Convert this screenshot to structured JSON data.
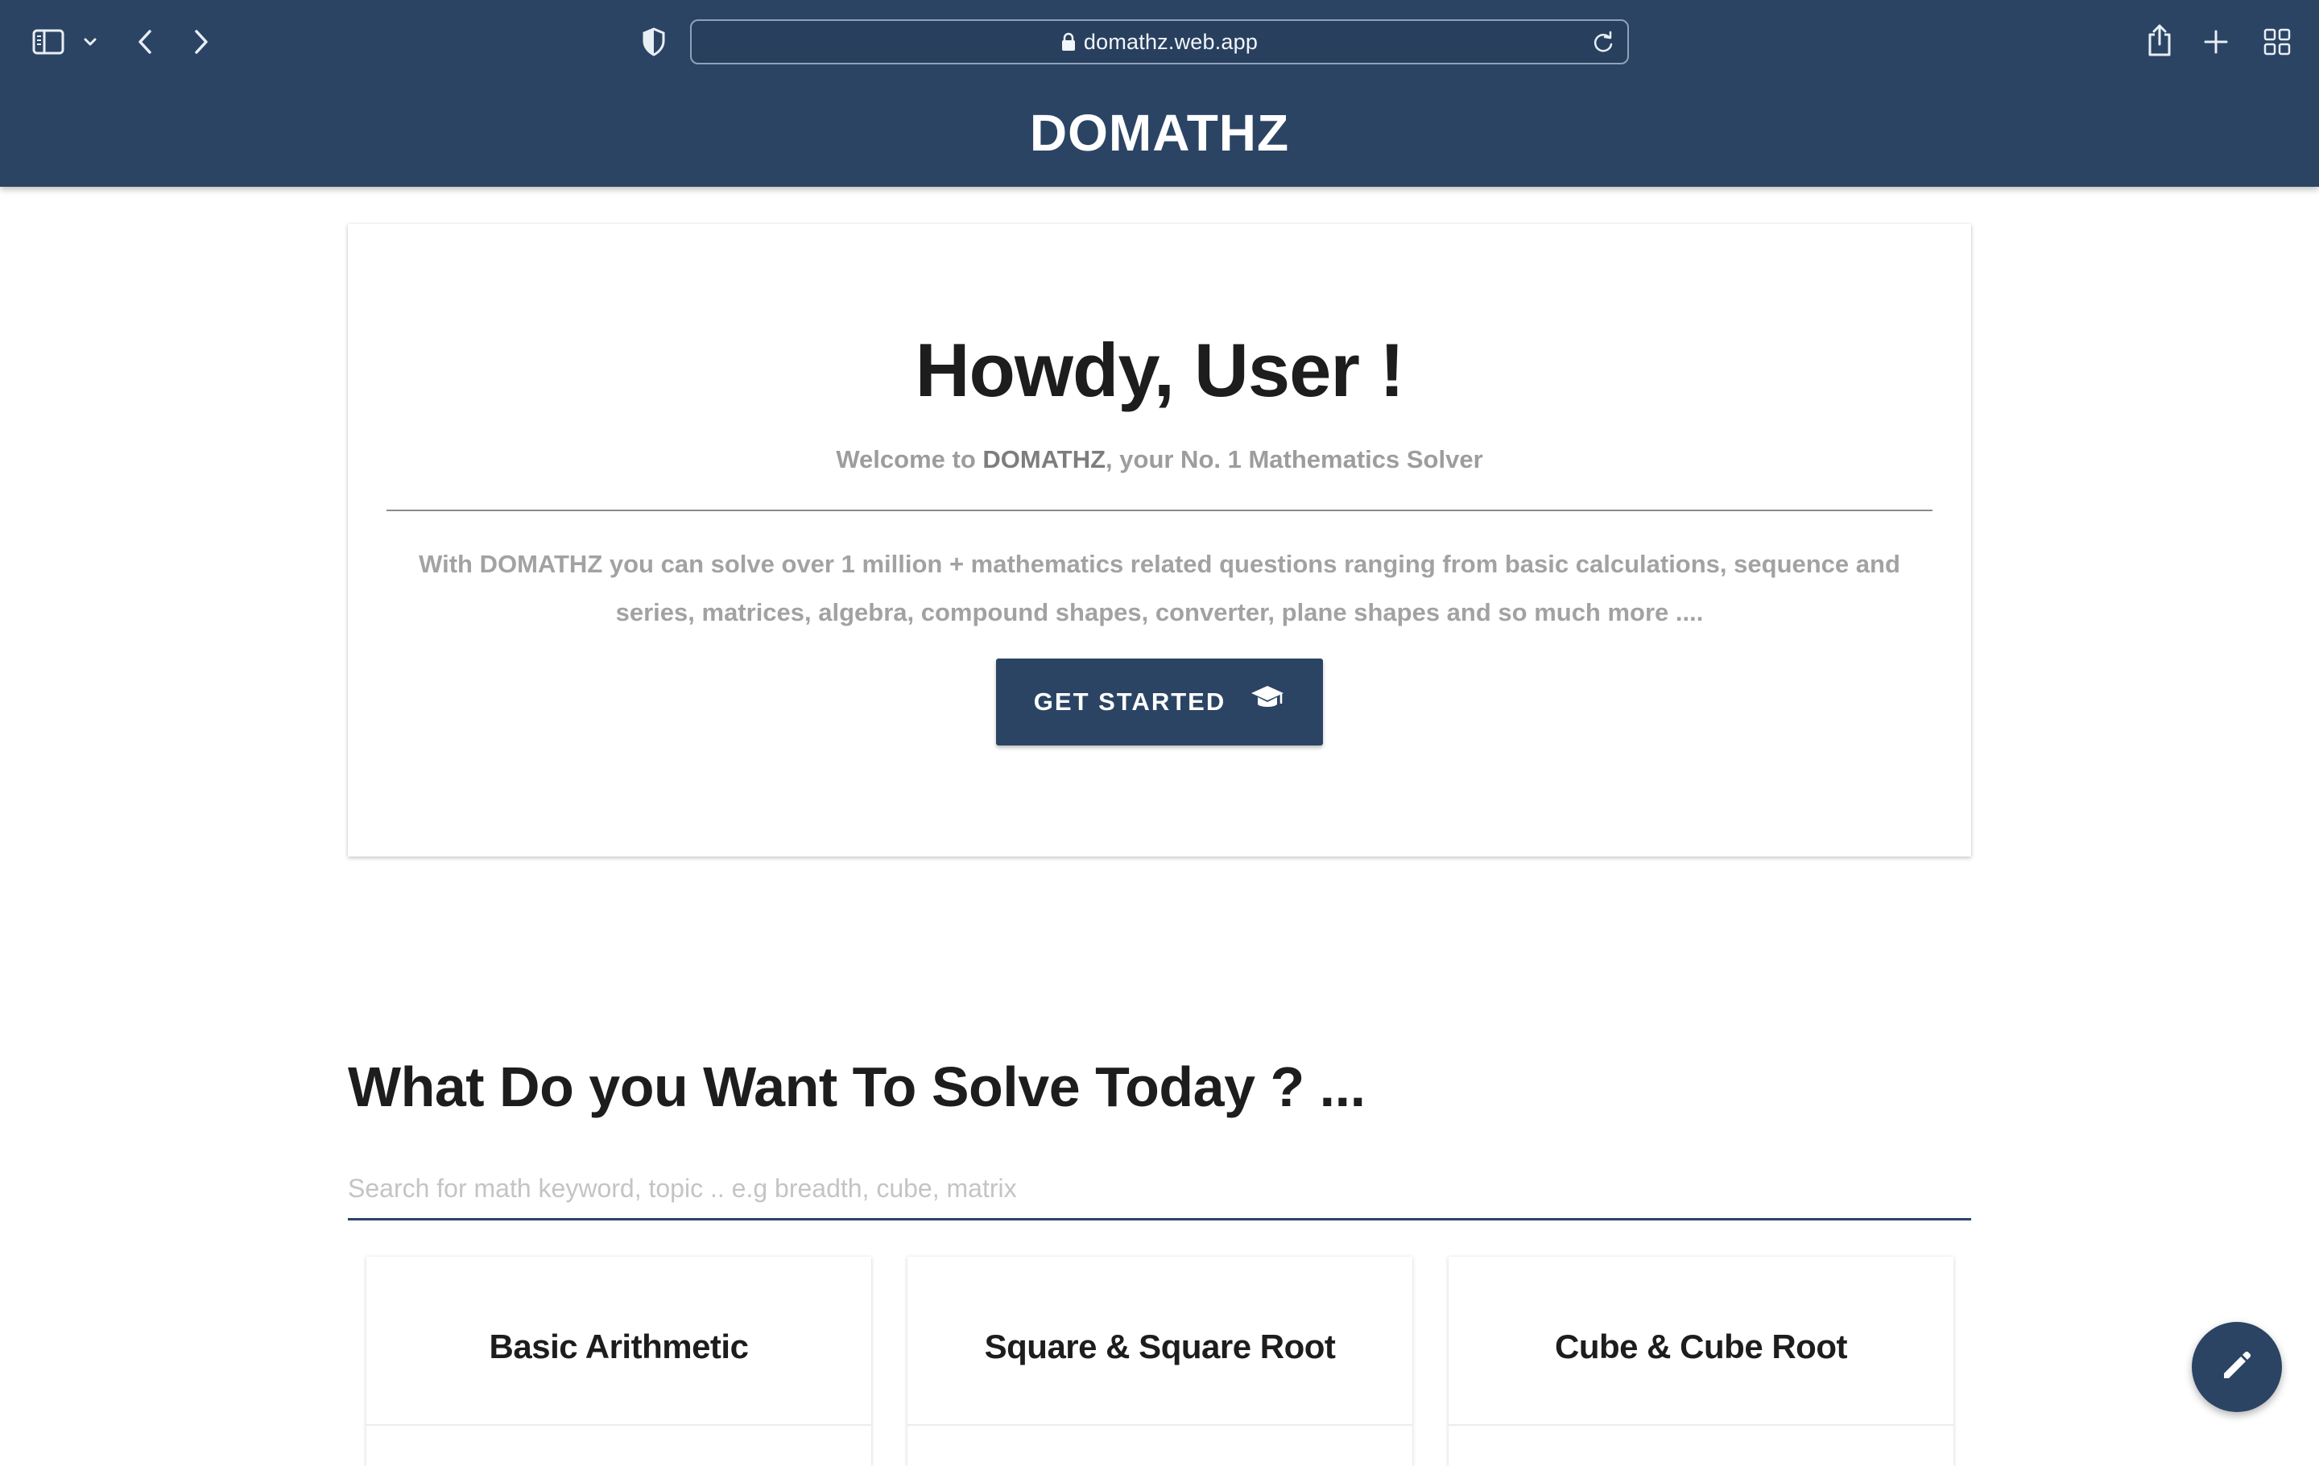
{
  "browser": {
    "url": "domathz.web.app",
    "icons": [
      "sidebar-icon",
      "chevron-down-icon",
      "back-icon",
      "forward-icon",
      "shield-icon",
      "lock-icon",
      "reload-icon",
      "share-icon",
      "new-tab-icon",
      "tab-overview-icon"
    ]
  },
  "header": {
    "brand": "DOMATHZ"
  },
  "hero": {
    "greeting": "Howdy, User !",
    "welcome_prefix": "Welcome to ",
    "welcome_brand": "DOMATHZ",
    "welcome_suffix": ", your No. 1 Mathematics Solver",
    "description": "With DOMATHZ you can solve over 1 million + mathematics related questions ranging from basic calculations, sequence and series, matrices, algebra, compound shapes, converter, plane shapes and so much more ....",
    "cta_label": "GET STARTED",
    "cta_icon": "graduation-cap-icon"
  },
  "solve": {
    "title": "What Do you Want To Solve Today ? ...",
    "search_placeholder": "Search for math keyword, topic .. e.g breadth, cube, matrix",
    "search_value": ""
  },
  "topics": [
    {
      "title": "Basic Arithmetic"
    },
    {
      "title": "Square & Square Root"
    },
    {
      "title": "Cube & Cube Root"
    }
  ],
  "fab": {
    "icon": "pencil-icon"
  },
  "colors": {
    "primary": "#2b4464",
    "heading_text": "#1d1d1d",
    "muted_text": "#a2a2a2"
  }
}
